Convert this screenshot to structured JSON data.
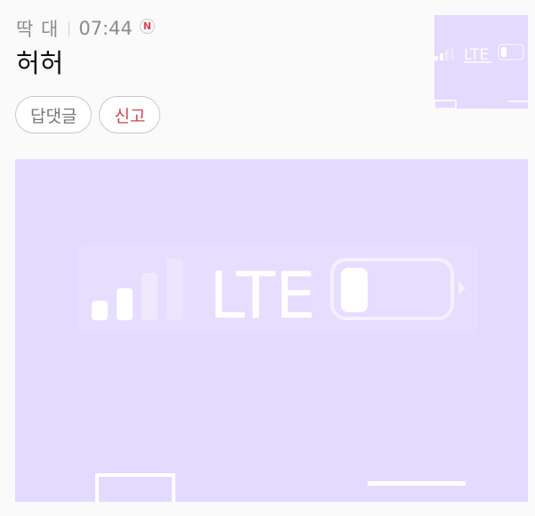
{
  "comment": {
    "author": "딱 대",
    "time": "07:44",
    "new_badge": "N",
    "text": "허허"
  },
  "actions": {
    "reply_label": "답댓글",
    "report_label": "신고"
  },
  "attachment": {
    "network_label": "LTE",
    "background_color": "#e4d9ff",
    "report_color": "#d4424d"
  }
}
